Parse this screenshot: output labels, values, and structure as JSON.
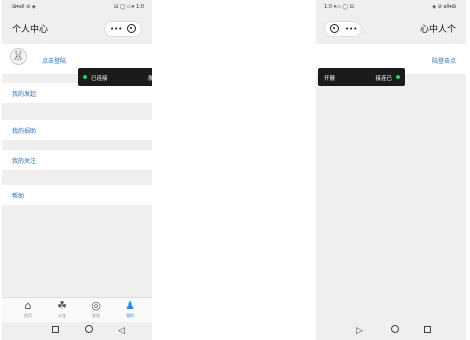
{
  "left": {
    "status": {
      "left": "⊞▾all ⊘ ◈",
      "right": "⊟ ◯ ▭▾ 1:0"
    },
    "title": "个人中心",
    "capsule": {
      "dots": "•••"
    },
    "profile": {
      "avatar": "🐰",
      "name": "点击登陆"
    },
    "toast": {
      "text": "已连接",
      "action": "展开"
    },
    "menu": [
      "我的发起",
      "我的捐助",
      "我的关注",
      "帮助"
    ],
    "tabs": [
      {
        "icon": "⌂",
        "label": "首页"
      },
      {
        "icon": "☘",
        "label": "沙龙"
      },
      {
        "icon": "◎",
        "label": "发现"
      },
      {
        "icon": "♟",
        "label": "我的"
      }
    ],
    "nav": {
      "back": "◁"
    }
  },
  "right": {
    "status": {
      "left": "1:0 ▾▭ ◯ ⊟",
      "right": "◈ ⊘ all▾⊞"
    },
    "title": "心中人个",
    "capsule": {
      "dots": "•••"
    },
    "profile": {
      "name": "陆登击点"
    },
    "toast": {
      "text": "接连已",
      "action": "开展"
    },
    "nav": {
      "back": "▷"
    }
  }
}
